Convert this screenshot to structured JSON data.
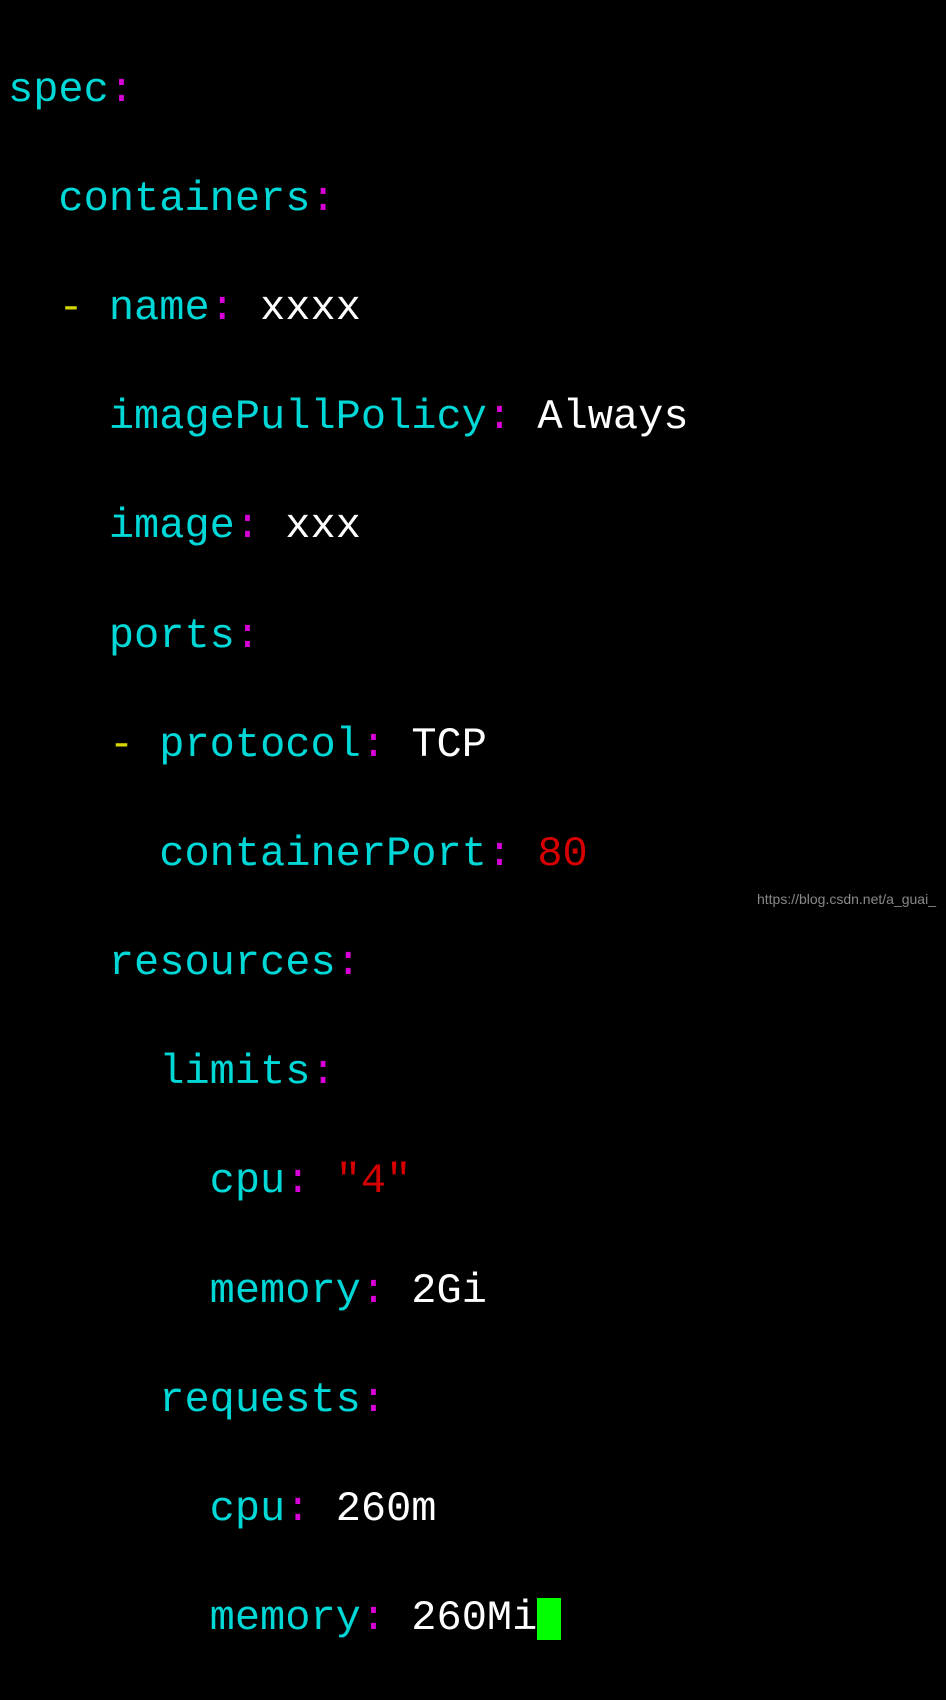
{
  "yaml": {
    "line1": {
      "key": "spec",
      "colon": ":"
    },
    "line2": {
      "indent": "  ",
      "key": "containers",
      "colon": ":"
    },
    "line3": {
      "indent": "  ",
      "dash": "- ",
      "key": "name",
      "colon": ": ",
      "value": "xxxx"
    },
    "line4": {
      "indent": "    ",
      "key": "imagePullPolicy",
      "colon": ": ",
      "value": "Always"
    },
    "line5": {
      "indent": "    ",
      "key": "image",
      "colon": ": ",
      "value": "xxx"
    },
    "line6": {
      "indent": "    ",
      "key": "ports",
      "colon": ":"
    },
    "line7": {
      "indent": "    ",
      "dash": "- ",
      "key": "protocol",
      "colon": ": ",
      "value": "TCP"
    },
    "line8": {
      "indent": "      ",
      "key": "containerPort",
      "colon": ": ",
      "value": "80"
    },
    "line9": {
      "indent": "    ",
      "key": "resources",
      "colon": ":"
    },
    "line10": {
      "indent": "      ",
      "key": "limits",
      "colon": ":"
    },
    "line11": {
      "indent": "        ",
      "key": "cpu",
      "colon": ": ",
      "quote1": "\"",
      "value": "4",
      "quote2": "\""
    },
    "line12": {
      "indent": "        ",
      "key": "memory",
      "colon": ": ",
      "value": "2Gi"
    },
    "line13": {
      "indent": "      ",
      "key": "requests",
      "colon": ":"
    },
    "line14": {
      "indent": "        ",
      "key": "cpu",
      "colon": ": ",
      "value": "260m"
    },
    "line15": {
      "indent": "        ",
      "key": "memory",
      "colon": ": ",
      "value": "260Mi"
    }
  },
  "watermark": "https://blog.csdn.net/a_guai_"
}
